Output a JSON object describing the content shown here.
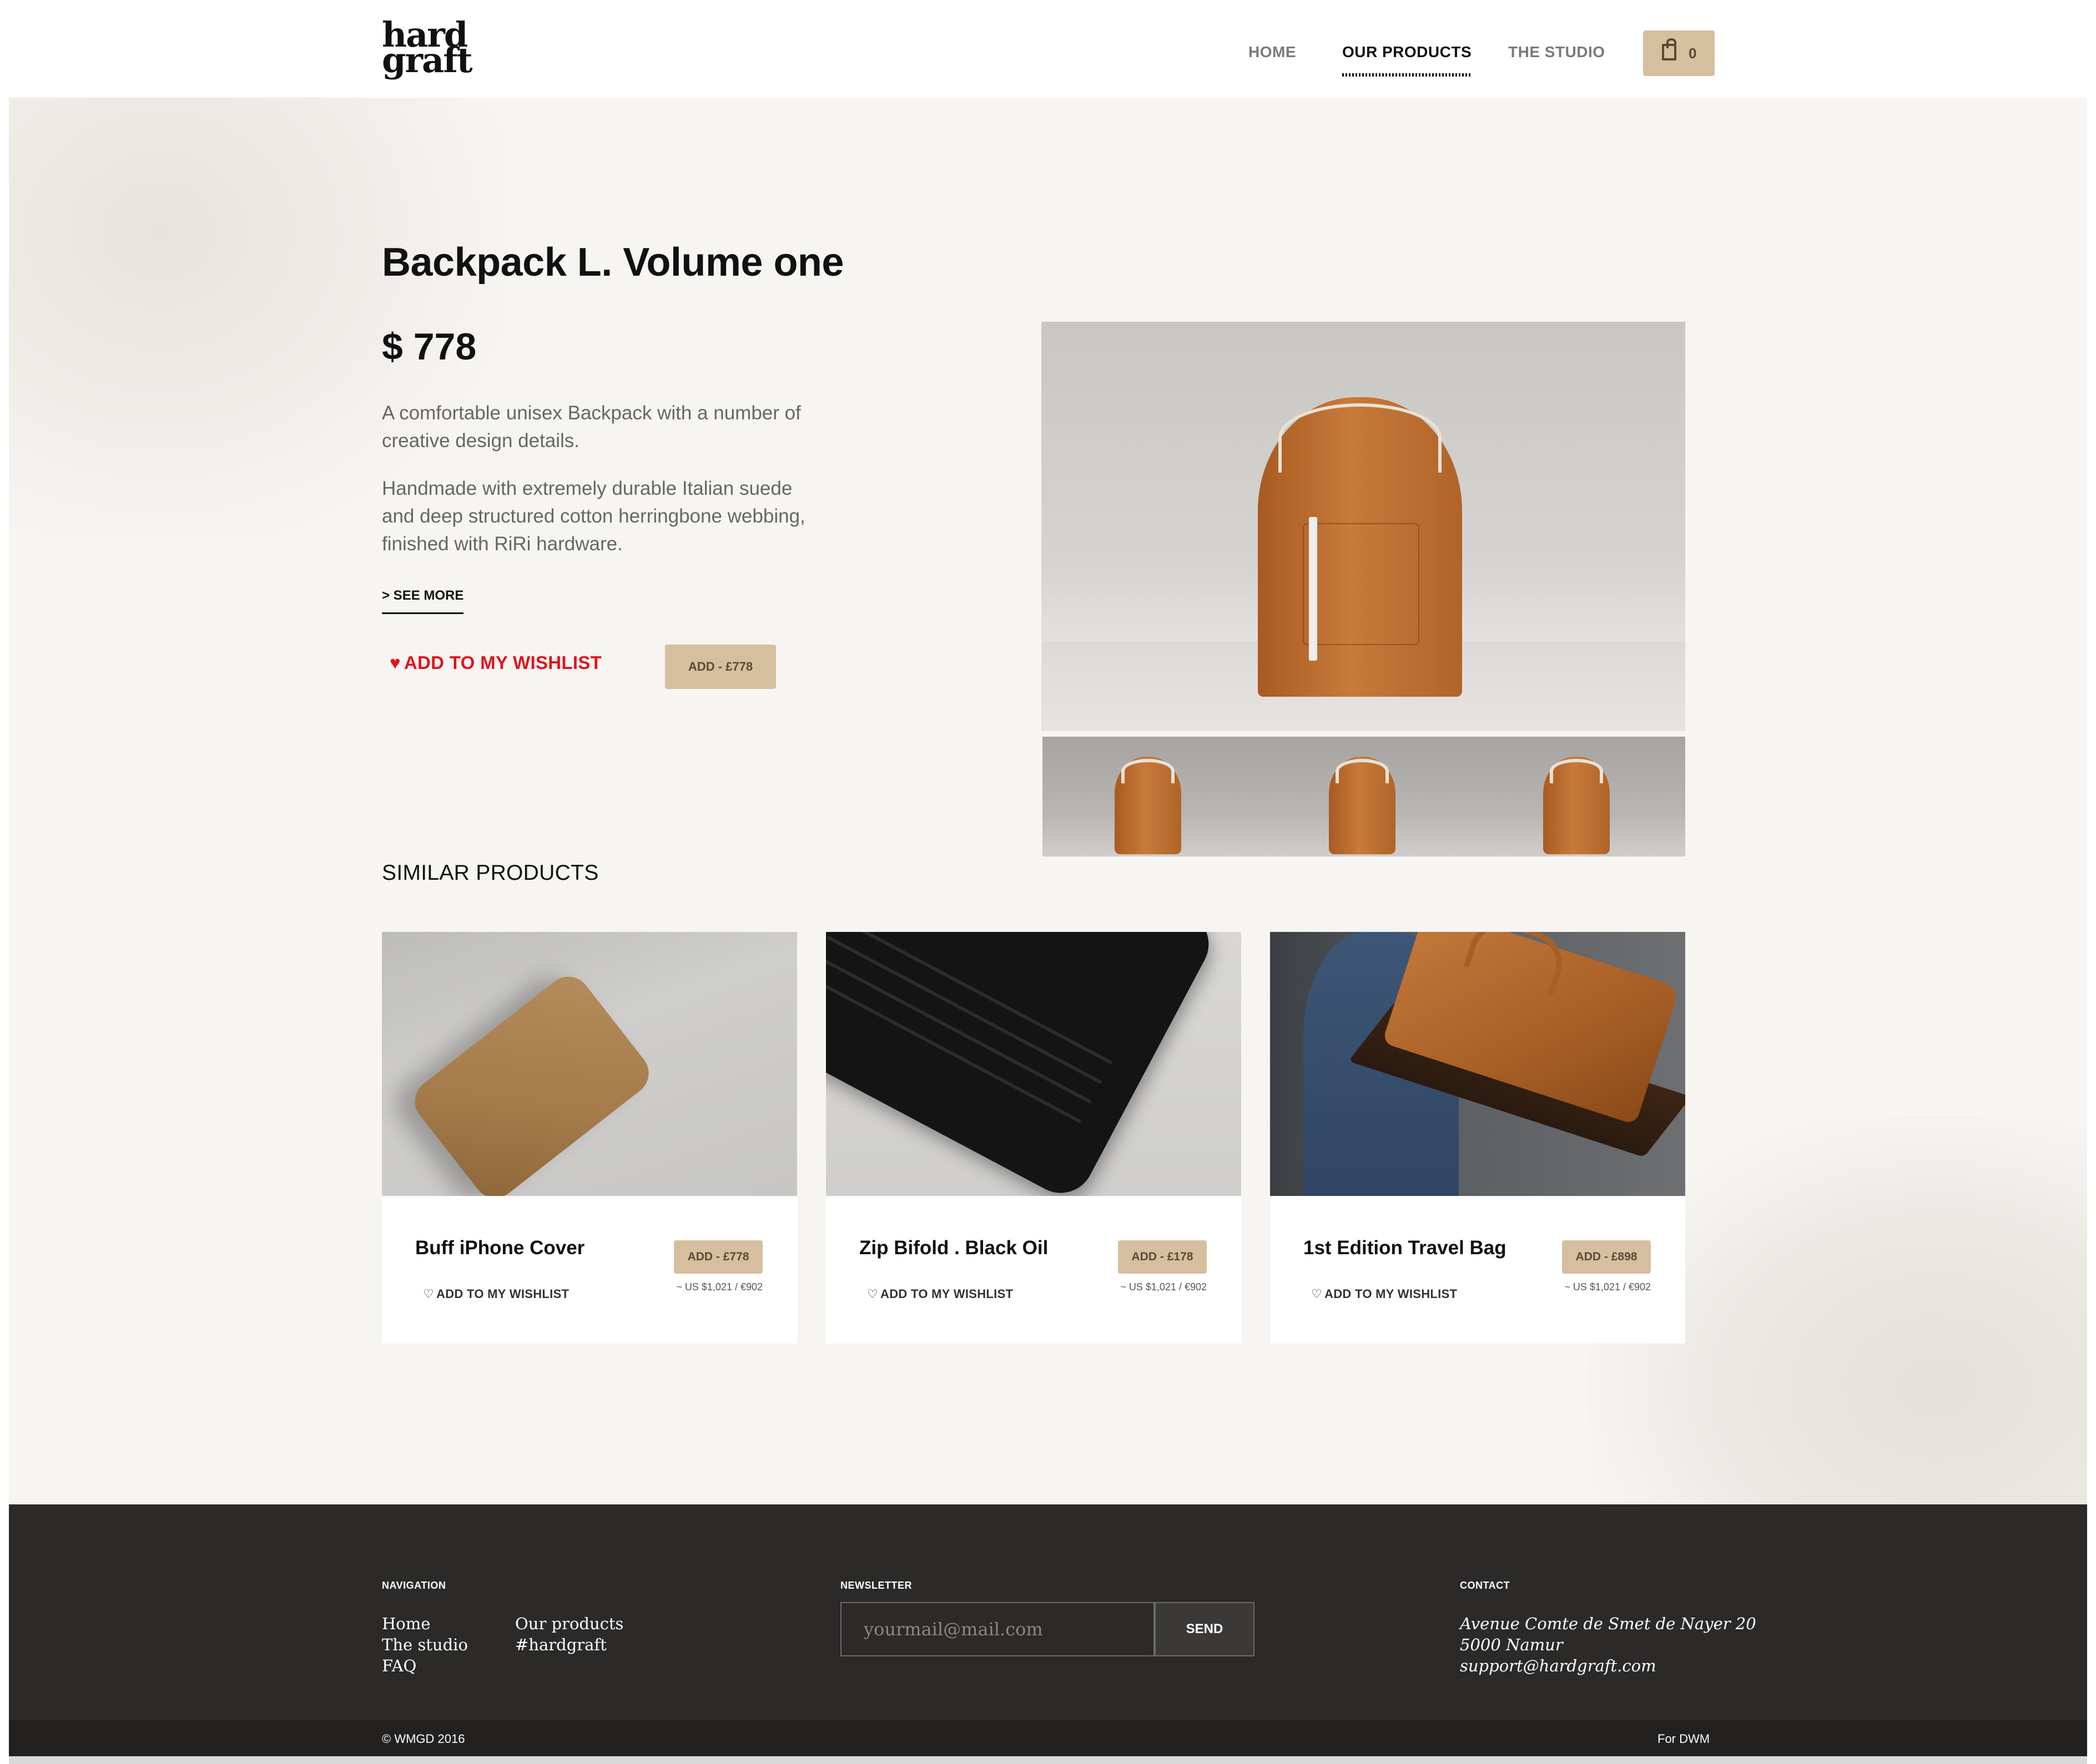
{
  "header": {
    "logo_line1": "hard",
    "logo_line2": "graft",
    "nav": [
      "HOME",
      "OUR PRODUCTS",
      "THE STUDIO"
    ],
    "cart_count": "0"
  },
  "product": {
    "title": "Backpack L. Volume one",
    "price": "$ 778",
    "description_1": "A comfortable unisex Backpack with a number of creative design details.",
    "description_2": "Handmade with extremely durable Italian suede and deep structured cotton herringbone webbing, finished with RiRi hardware.",
    "see_more": "> SEE MORE",
    "wishlist": "ADD TO MY WISHLIST",
    "add_button": "ADD - £778"
  },
  "similar": {
    "title": "SIMILAR PRODUCTS",
    "items": [
      {
        "name": "Buff iPhone Cover",
        "button": "ADD - £778",
        "note": "~ US $1,021 / €902",
        "wishlist": "ADD TO MY WISHLIST"
      },
      {
        "name": "Zip Bifold . Black Oil",
        "button": "ADD - £178",
        "note": "~ US $1,021 / €902",
        "wishlist": "ADD TO MY WISHLIST"
      },
      {
        "name": "1st Edition Travel Bag",
        "button": "ADD - £898",
        "note": "~ US $1,021 / €902",
        "wishlist": "ADD TO MY WISHLIST"
      }
    ]
  },
  "footer": {
    "navigation_title": "NAVIGATION",
    "nav_links": [
      "Home",
      "The studio",
      "FAQ",
      "Our products",
      "#hardgraft"
    ],
    "newsletter_title": "NEWSLETTER",
    "newsletter_placeholder": "yourmail@mail.com",
    "newsletter_button": "SEND",
    "contact_title": "CONTACT",
    "contact_lines": [
      "Avenue Comte de Smet de Nayer 20",
      "5000 Namur",
      "support@hardgraft.com"
    ],
    "copyright": "© WMGD 2016",
    "credit": "For DWM"
  },
  "colors": {
    "accent_button": "#d5bf9f",
    "wishlist_red": "#e0141e",
    "footer_bg": "#2b2a29",
    "page_bg": "#f7f5f2"
  }
}
